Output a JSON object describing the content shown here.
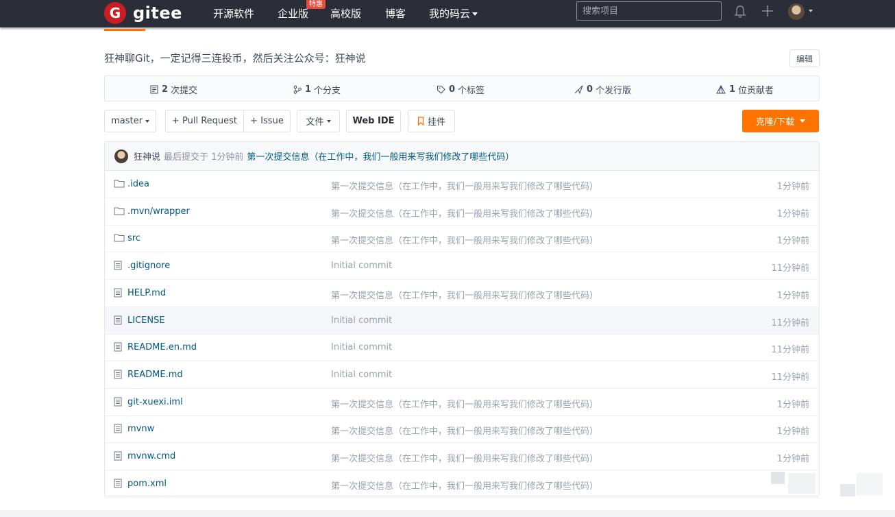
{
  "header": {
    "logo_text": "gitee",
    "nav": [
      {
        "label": "开源软件"
      },
      {
        "label": "企业版"
      },
      {
        "label": "高校版"
      },
      {
        "label": "博客"
      },
      {
        "label": "我的码云"
      }
    ],
    "badge": "特惠",
    "search_placeholder": "搜索项目",
    "icons": [
      "bell-icon",
      "plus-icon",
      "avatar"
    ]
  },
  "repo": {
    "description": "狂神聊Git，一定记得三连投币，然后关注公众号：狂神说",
    "edit_label": "编辑",
    "stats": [
      {
        "count": "2",
        "label": "次提交",
        "icon": "commit-icon"
      },
      {
        "count": "1",
        "label": "个分支",
        "icon": "branch-icon"
      },
      {
        "count": "0",
        "label": "个标签",
        "icon": "tag-icon"
      },
      {
        "count": "0",
        "label": "个发行版",
        "icon": "release-icon"
      },
      {
        "count": "1",
        "label": "位贡献者",
        "icon": "contributor-icon"
      }
    ]
  },
  "toolbar": {
    "branch": "master",
    "pull_request": "+ Pull Request",
    "issue": "+ Issue",
    "file_menu": "文件",
    "web_ide": "Web IDE",
    "widget": "挂件",
    "clone": "克隆/下载"
  },
  "latest_commit": {
    "author": "狂神说",
    "meta": "最后提交于 1分钟前",
    "message": "第一次提交信息（在工作中，我们一般用来写我们修改了哪些代码）"
  },
  "files": [
    {
      "name": ".idea",
      "type": "folder",
      "message": "第一次提交信息（在工作中，我们一般用来写我们修改了哪些代码）",
      "time": "1分钟前"
    },
    {
      "name": ".mvn/wrapper",
      "type": "folder",
      "message": "第一次提交信息（在工作中，我们一般用来写我们修改了哪些代码）",
      "time": "1分钟前"
    },
    {
      "name": "src",
      "type": "folder",
      "message": "第一次提交信息（在工作中，我们一般用来写我们修改了哪些代码）",
      "time": "1分钟前"
    },
    {
      "name": ".gitignore",
      "type": "file",
      "message": "Initial commit",
      "time": "11分钟前"
    },
    {
      "name": "HELP.md",
      "type": "file",
      "message": "第一次提交信息（在工作中，我们一般用来写我们修改了哪些代码）",
      "time": "1分钟前"
    },
    {
      "name": "LICENSE",
      "type": "file",
      "message": "Initial commit",
      "time": "11分钟前"
    },
    {
      "name": "README.en.md",
      "type": "file",
      "message": "Initial commit",
      "time": "11分钟前"
    },
    {
      "name": "README.md",
      "type": "file",
      "message": "Initial commit",
      "time": "11分钟前"
    },
    {
      "name": "git-xuexi.iml",
      "type": "file",
      "message": "第一次提交信息（在工作中，我们一般用来写我们修改了哪些代码）",
      "time": "1分钟前"
    },
    {
      "name": "mvnw",
      "type": "file",
      "message": "第一次提交信息（在工作中，我们一般用来写我们修改了哪些代码）",
      "time": "1分钟前"
    },
    {
      "name": "mvnw.cmd",
      "type": "file",
      "message": "第一次提交信息（在工作中，我们一般用来写我们修改了哪些代码）",
      "time": "1分钟前"
    },
    {
      "name": "pom.xml",
      "type": "file",
      "message": "第一次提交信息（在工作中，我们一般用来写我们修改了哪些代码）"
    }
  ],
  "colors": {
    "accent": "#fe7300",
    "brand": "#c71d23",
    "header_bg": "#2b2e38",
    "link": "#005980"
  }
}
